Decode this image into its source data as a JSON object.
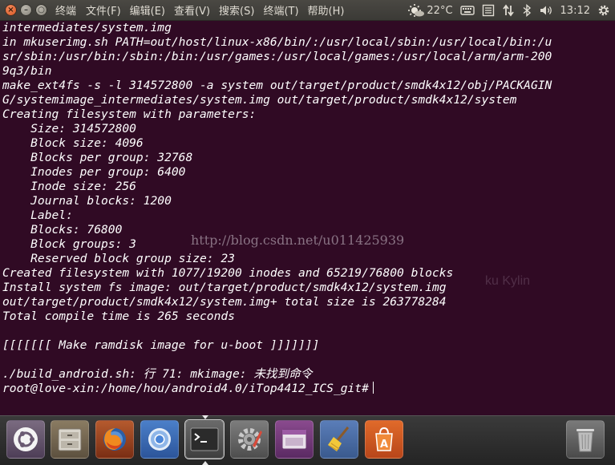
{
  "topbar": {
    "app_title": "终端",
    "menus": [
      "文件(F)",
      "编辑(E)",
      "查看(V)",
      "搜索(S)",
      "终端(T)",
      "帮助(H)"
    ],
    "weather": "22°C",
    "time": "13:12",
    "icons": [
      "weather-sun-icon",
      "keyboard-icon",
      "mail-icon",
      "network-arrows-icon",
      "bluetooth-icon",
      "volume-icon",
      "gear-icon"
    ]
  },
  "terminal": {
    "lines": [
      "intermediates/system.img",
      "in mkuserimg.sh PATH=out/host/linux-x86/bin/:/usr/local/sbin:/usr/local/bin:/u",
      "sr/sbin:/usr/bin:/sbin:/bin:/usr/games:/usr/local/games:/usr/local/arm/arm-200",
      "9q3/bin",
      "make_ext4fs -s -l 314572800 -a system out/target/product/smdk4x12/obj/PACKAGIN",
      "G/systemimage_intermediates/system.img out/target/product/smdk4x12/system",
      "Creating filesystem with parameters:",
      "    Size: 314572800",
      "    Block size: 4096",
      "    Blocks per group: 32768",
      "    Inodes per group: 6400",
      "    Inode size: 256",
      "    Journal blocks: 1200",
      "    Label:",
      "    Blocks: 76800",
      "    Block groups: 3",
      "    Reserved block group size: 23",
      "Created filesystem with 1077/19200 inodes and 65219/76800 blocks",
      "Install system fs image: out/target/product/smdk4x12/system.img",
      "out/target/product/smdk4x12/system.img+ total size is 263778284",
      "Total compile time is 265 seconds",
      "",
      "[[[[[[[ Make ramdisk image for u-boot ]]]]]]]",
      "",
      "./build_android.sh: 行 71: mkimage: 未找到命令"
    ],
    "prompt": "root@love-xin:/home/hou/android4.0/iTop4412_ICS_git#",
    "watermark": "http://blog.csdn.net/u011425939",
    "ghost_text": "ku Kylin"
  },
  "dock": {
    "items": [
      "ubuntu-dash-icon",
      "files-icon",
      "firefox-icon",
      "chromium-icon",
      "terminal-icon",
      "settings-icon",
      "screen-recorder-icon",
      "cleaner-broom-icon",
      "software-center-icon",
      "trash-icon"
    ],
    "active": "terminal-icon"
  }
}
